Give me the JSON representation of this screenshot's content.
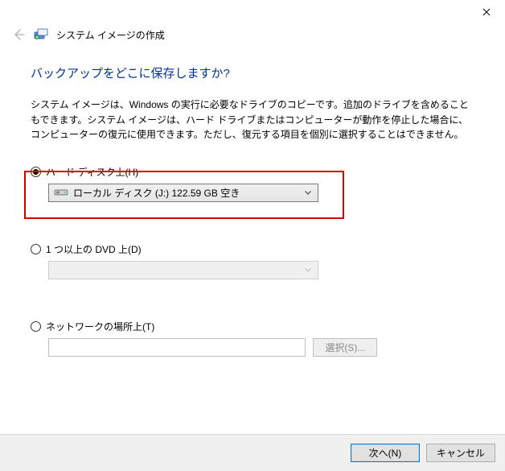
{
  "window": {
    "app_title": "システム イメージの作成"
  },
  "page": {
    "heading": "バックアップをどこに保存しますか?",
    "description": "システム イメージは、Windows の実行に必要なドライブのコピーです。追加のドライブを含めることもできます。システム イメージは、ハード ドライブまたはコンピューターが動作を停止した場合に、コンピューターの復元に使用できます。ただし、復元する項目を個別に選択することはできません。"
  },
  "options": {
    "hard_disk": {
      "label": "ハード ディスク上(H)",
      "selected_drive": "ローカル ディスク (J:)  122.59 GB 空き",
      "checked": true
    },
    "dvd": {
      "label": "1 つ以上の DVD 上(D)",
      "checked": false
    },
    "network": {
      "label": "ネットワークの場所上(T)",
      "browse_label": "選択(S)...",
      "checked": false
    }
  },
  "footer": {
    "next_label": "次へ(N)",
    "cancel_label": "キャンセル"
  }
}
